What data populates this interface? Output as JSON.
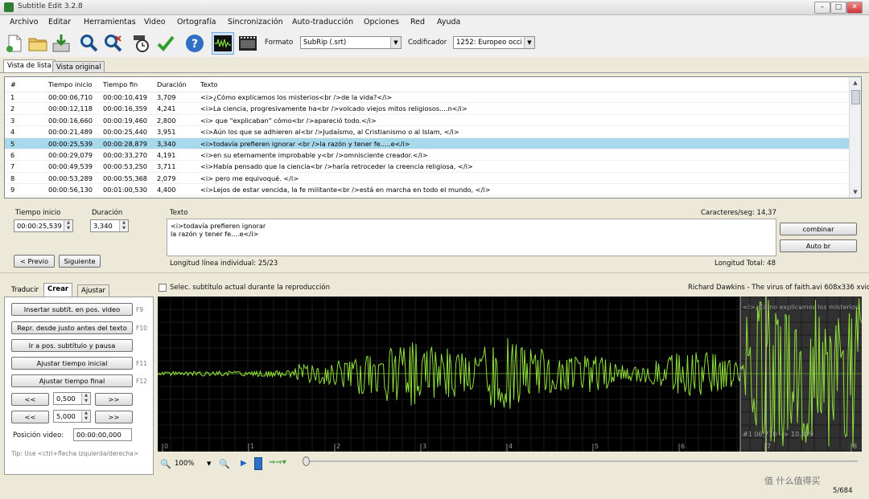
{
  "window": {
    "title": "Subtitle Edit 3.2.8"
  },
  "menu": [
    "Archivo",
    "Editar",
    "Herramientas",
    "Video",
    "Ortografía",
    "Sincronización",
    "Auto-traducción",
    "Opciones",
    "Red",
    "Ayuda"
  ],
  "toolbar": {
    "icons": [
      "new-file-icon",
      "open-folder-icon",
      "save-icon",
      "find-icon",
      "replace-icon",
      "fix-timing-icon",
      "check-icon",
      "help-icon",
      "waveform-icon",
      "video-icon"
    ],
    "format_label": "Formato",
    "format_value": "SubRip (.srt)",
    "encoding_label": "Codificador",
    "encoding_value": "1252: Europeo occi"
  },
  "tabs": {
    "list_view": "Vista de lista",
    "source_view": "Vista original"
  },
  "list": {
    "headers": [
      "#",
      "Tiempo inicio",
      "Tiempo fin",
      "Duración",
      "Texto"
    ],
    "rows": [
      [
        "1",
        "00:00:06,710",
        "00:00:10,419",
        "3,709",
        "<i>¿Cómo explicamos los misterios<br />de la vida?</i>"
      ],
      [
        "2",
        "00:00:12,118",
        "00:00:16,359",
        "4,241",
        "<i>La ciencia, progresivamente ha<br />volcado viejos mitos religiosos....n</i>"
      ],
      [
        "3",
        "00:00:16,660",
        "00:00:19,460",
        "2,800",
        "<i> que \"explicaban\" cómo<br />apareció todo.</i>"
      ],
      [
        "4",
        "00:00:21,489",
        "00:00:25,440",
        "3,951",
        "<i>Aún los que se adhieren al<br />Judaísmo, al Cristianismo o al Islam, </i>"
      ],
      [
        "5",
        "00:00:25,539",
        "00:00:28,879",
        "3,340",
        "<i>todavía prefieren ignorar <br />la razón y tener fe.....e</i>"
      ],
      [
        "6",
        "00:00:29,079",
        "00:00:33,270",
        "4,191",
        "<i>en su eternamente improbable y<br />omnisciente creador.</i>"
      ],
      [
        "7",
        "00:00:49,539",
        "00:00:53,250",
        "3,711",
        "<i>Había pensado que la ciencia<br />haría retroceder la creencia religiosa, </i>"
      ],
      [
        "8",
        "00:00:53,289",
        "00:00:55,368",
        "2,079",
        "<i> pero me equivoqué. </i>"
      ],
      [
        "9",
        "00:00:56,130",
        "00:01:00,530",
        "4,400",
        "<i>Lejos de estar vencida, la fe militante<br />está en marcha en todo el mundo, </i>"
      ]
    ],
    "selected_index": 4
  },
  "edit": {
    "start_label": "Tiempo inicio",
    "start_value": "00:00:25,539",
    "duration_label": "Duración",
    "duration_value": "3,340",
    "text_label": "Texto",
    "chars_per_sec": "Caracteres/seg: 14,37",
    "text_lines": [
      "<i>todavía prefieren ignorar",
      "la razón y tener fe....e</i>"
    ],
    "prev_button": "< Previo",
    "next_button": "Siguiente",
    "line_length": "Longitud línea individual:  25/23",
    "total_length": "Longitud Total: 48",
    "combine_button": "combinar",
    "auto_br_button": "Auto br"
  },
  "lower_tabs": [
    "Traducir",
    "Crear",
    "Ajustar"
  ],
  "follow_checkbox": "Selec. subtítulo actual durante la reproducción",
  "video_info": "Richard Dawkins - The virus of faith.avi 608x336 xvid",
  "create": {
    "buttons": [
      {
        "label": "Insertar subtít. en pos. video",
        "key": "F9"
      },
      {
        "label": "Repr. desde justo antes del texto",
        "key": "F10"
      },
      {
        "label": "Ir a pos. subtítulo y pausa",
        "key": ""
      },
      {
        "label": "Ajustar tiempo inicial",
        "key": "F11"
      },
      {
        "label": "Ajustar tiempo final",
        "key": "F12"
      }
    ],
    "back": "<<",
    "fwd": ">>",
    "step1": "0,500",
    "step2": "5,000",
    "video_pos_label": "Posición video:",
    "video_pos_value": "00:00:00,000",
    "tip": "Tip: Use <ctrl+flecha izquierda/derecha>"
  },
  "waveform": {
    "subtitle_text": "<i>¿Cómo explicamos los misterios",
    "subtitle_time": "#1  06,710 --> 10,419",
    "ticks": [
      "0",
      "1",
      "2",
      "3",
      "4",
      "5",
      "6",
      "7",
      "8"
    ],
    "zoom": "100%"
  },
  "status": {
    "position": "5/684"
  },
  "watermark": "值 什么值得买"
}
